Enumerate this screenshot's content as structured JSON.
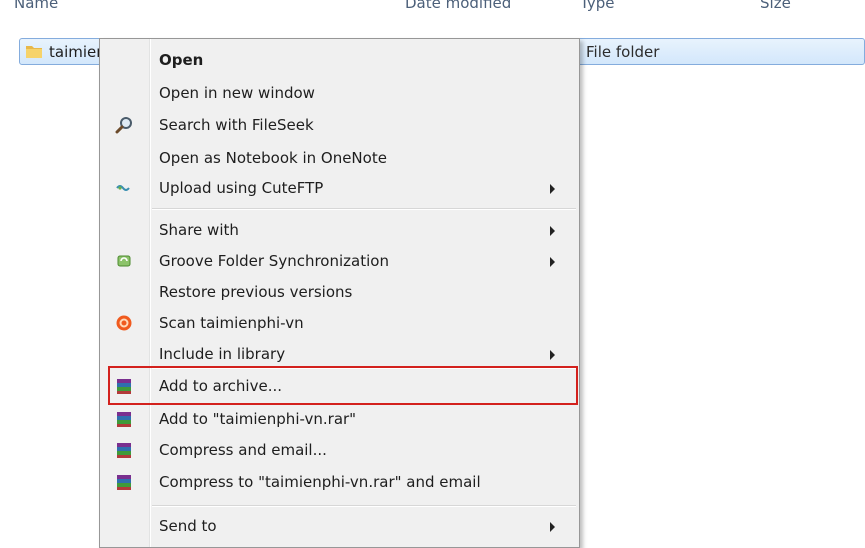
{
  "columns": [
    "Name",
    "Date modified",
    "Type",
    "Size"
  ],
  "file": {
    "name": "taimien",
    "type": "File folder"
  },
  "menu": {
    "items": [
      {
        "label": "Open",
        "bold": true,
        "icon": "",
        "submenu": false
      },
      {
        "label": "Open in new window",
        "icon": "",
        "submenu": false
      },
      {
        "label": "Search with FileSeek",
        "icon": "magnifier-icon",
        "submenu": false
      },
      {
        "label": "Open as Notebook in OneNote",
        "icon": "",
        "submenu": false
      },
      {
        "label": "Upload using CuteFTP",
        "icon": "cuteftp-icon",
        "submenu": true
      },
      {
        "label": "Share with",
        "icon": "",
        "submenu": true
      },
      {
        "label": "Groove Folder Synchronization",
        "icon": "groove-icon",
        "submenu": true
      },
      {
        "label": "Restore previous versions",
        "icon": "",
        "submenu": false
      },
      {
        "label": "Scan taimienphi-vn",
        "icon": "antivirus-icon",
        "submenu": false
      },
      {
        "label": "Include in library",
        "icon": "",
        "submenu": true
      },
      {
        "label": "Add to archive...",
        "icon": "winrar-icon",
        "submenu": false,
        "highlighted": true
      },
      {
        "label": "Add to \"taimienphi-vn.rar\"",
        "icon": "winrar-icon",
        "submenu": false
      },
      {
        "label": "Compress and email...",
        "icon": "winrar-icon",
        "submenu": false
      },
      {
        "label": "Compress to \"taimienphi-vn.rar\" and email",
        "icon": "winrar-icon",
        "submenu": false
      },
      {
        "label": "Send to",
        "icon": "",
        "submenu": true
      }
    ]
  },
  "colors": {
    "highlight_border": "#d3211d",
    "selection": "#d3e7fb"
  }
}
